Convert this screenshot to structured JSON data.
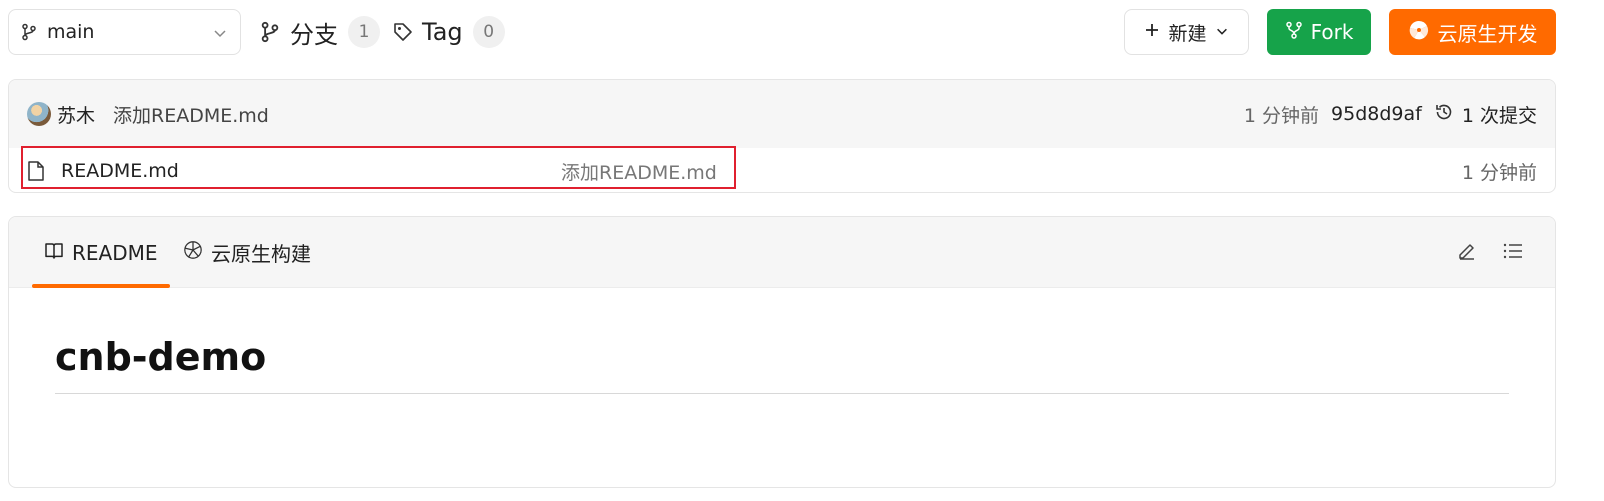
{
  "toolbar": {
    "branch": {
      "label": "main",
      "icon": "git-branch-icon"
    },
    "branches": {
      "label": "分支",
      "count": "1",
      "icon": "git-branch-icon"
    },
    "tags": {
      "label": "Tag",
      "count": "0",
      "icon": "tag-icon"
    },
    "new_button": {
      "label": "新建",
      "icon": "plus-icon"
    },
    "fork_button": {
      "label": "Fork",
      "icon": "fork-icon",
      "color": "#16a34a"
    },
    "cloud_button": {
      "label": "云原生开发",
      "icon": "cloud-native-icon",
      "color": "#ff6a00"
    }
  },
  "commit": {
    "author": "苏木",
    "message": "添加README.md",
    "time": "1 分钟前",
    "hash": "95d8d9af",
    "commits_label": "1 次提交"
  },
  "files": [
    {
      "name": "README.md",
      "message": "添加README.md",
      "time": "1 分钟前",
      "icon": "file-icon"
    }
  ],
  "readme": {
    "tabs": [
      {
        "label": "README",
        "icon": "book-icon",
        "active": true
      },
      {
        "label": "云原生构建",
        "icon": "build-icon",
        "active": false
      }
    ],
    "title": "cnb-demo"
  },
  "colors": {
    "accent": "#ff6a00",
    "success": "#16a34a",
    "highlight": "#e0202f"
  }
}
